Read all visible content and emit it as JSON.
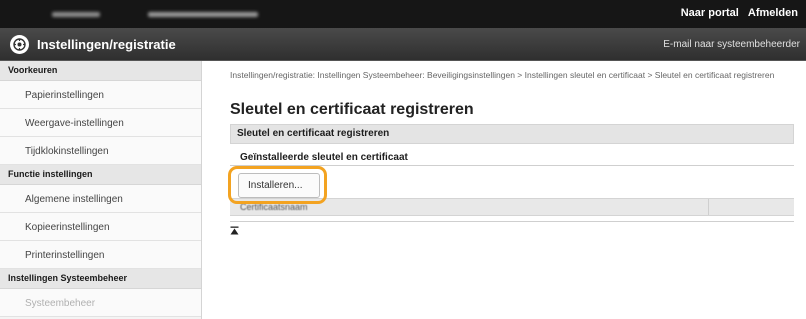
{
  "header": {
    "portal_link": "Naar portal",
    "logout_link": "Afmelden"
  },
  "titlebar": {
    "app_title": "Instellingen/registratie",
    "email_link": "E-mail naar systeembeheerder"
  },
  "sidebar": {
    "sections": [
      {
        "title": "Voorkeuren",
        "items": [
          {
            "label": "Papierinstellingen"
          },
          {
            "label": "Weergave-instellingen"
          },
          {
            "label": "Tijdklokinstellingen"
          }
        ]
      },
      {
        "title": "Functie instellingen",
        "items": [
          {
            "label": "Algemene instellingen"
          },
          {
            "label": "Kopieerinstellingen"
          },
          {
            "label": "Printerinstellingen"
          }
        ]
      },
      {
        "title": "Instellingen Systeembeheer",
        "items": [
          {
            "label": "Systeembeheer",
            "disabled": true
          }
        ]
      }
    ]
  },
  "main": {
    "breadcrumb": "Instellingen/registratie: Instellingen Systeembeheer: Beveiligingsinstellingen > Instellingen sleutel en certificaat > Sleutel en certificaat registreren",
    "page_title": "Sleutel en certificaat registreren",
    "section_title": "Sleutel en certificaat registreren",
    "subsection_title": "Geïnstalleerde sleutel en certificaat",
    "install_button": "Installeren...",
    "table_columns": [
      "Certificaatsnaam"
    ],
    "scroll_top_icon": "scroll-to-top-icon",
    "highlight_color": "#f3a321"
  }
}
